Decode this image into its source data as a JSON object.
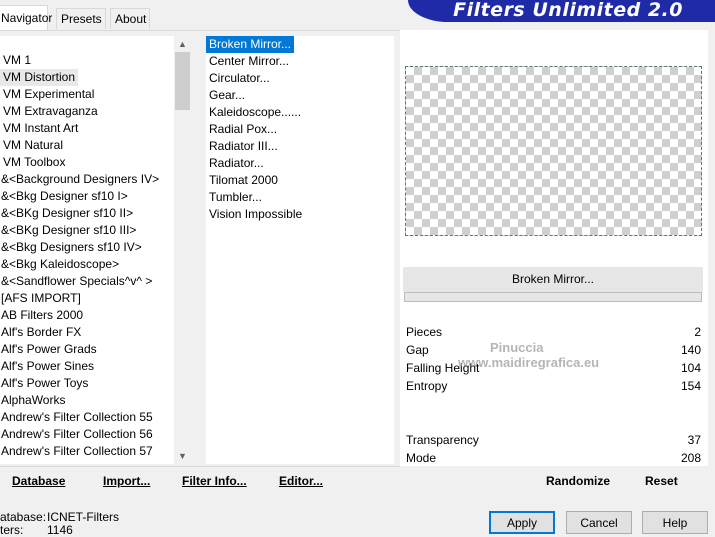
{
  "app": {
    "title": "Filters Unlimited 2.0"
  },
  "tabs": [
    {
      "label": "Navigator",
      "active": true
    },
    {
      "label": "Presets",
      "active": false
    },
    {
      "label": "About",
      "active": false
    }
  ],
  "categories": [
    "VM 1",
    "VM Distortion",
    "VM Experimental",
    "VM Extravaganza",
    "VM Instant Art",
    "VM Natural",
    "VM Toolbox",
    "&<Background Designers IV>",
    "&<Bkg Designer sf10 I>",
    "&<BKg Designer sf10 II>",
    "&<BKg Designer sf10 III>",
    "&<Bkg Designers sf10 IV>",
    "&<Bkg Kaleidoscope>",
    "&<Sandflower Specials^v^ >",
    "[AFS IMPORT]",
    "AB Filters 2000",
    "Alf's Border FX",
    "Alf's Power Grads",
    "Alf's Power Sines",
    "Alf's Power Toys",
    "AlphaWorks",
    "Andrew's Filter Collection 55",
    "Andrew's Filter Collection 56",
    "Andrew's Filter Collection 57"
  ],
  "selected_category": "VM Distortion",
  "filters": [
    "Broken Mirror...",
    "Center Mirror...",
    "Circulator...",
    "Gear...",
    "Kaleidoscope......",
    "Radial Pox...",
    "Radiator III...",
    "Radiator...",
    "Tilomat 2000",
    "Tumbler...",
    "Vision Impossible"
  ],
  "selected_filter": "Broken Mirror...",
  "preview": {
    "filter_name": "Broken Mirror...",
    "progress": 0
  },
  "params": [
    {
      "label": "Pieces",
      "value": "2"
    },
    {
      "label": "Gap",
      "value": "140"
    },
    {
      "label": "Falling Height",
      "value": "104"
    },
    {
      "label": "Entropy",
      "value": "154"
    },
    {
      "label": "Transparency",
      "value": "37"
    },
    {
      "label": "Mode",
      "value": "208"
    }
  ],
  "links": {
    "database": "Database",
    "import": "Import...",
    "filter_info": "Filter Info...",
    "editor": "Editor...",
    "randomize": "Randomize",
    "reset": "Reset"
  },
  "status": {
    "database_label": "atabase:",
    "database_value": "ICNET-Filters",
    "filters_label": "ters:",
    "filters_value": "1146"
  },
  "buttons": {
    "apply": "Apply",
    "cancel": "Cancel",
    "help": "Help"
  },
  "watermark": {
    "line1": "Pinuccia",
    "line2": "www.maidiregrafica.eu"
  },
  "colors": {
    "banner": "#1f2aa6",
    "selection": "#0078d7",
    "apply_border": "#0078d7"
  }
}
